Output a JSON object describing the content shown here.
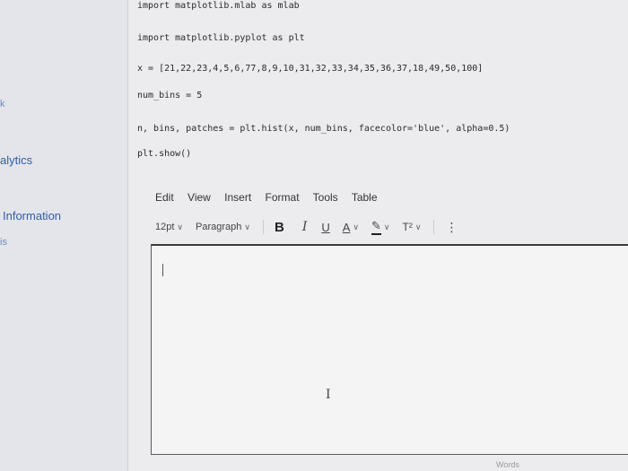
{
  "sidebar": {
    "items": [
      {
        "label": "k"
      },
      {
        "label": "alytics"
      },
      {
        "label": "Information"
      },
      {
        "label": "is"
      }
    ]
  },
  "code": {
    "lines": [
      "import matplotlib.mlab as mlab",
      "import matplotlib.pyplot as plt",
      "x = [21,22,23,4,5,6,77,8,9,10,31,32,33,34,35,36,37,18,49,50,100]",
      "num_bins = 5",
      "n, bins, patches = plt.hist(x, num_bins, facecolor='blue', alpha=0.5)",
      "plt.show()"
    ]
  },
  "editor": {
    "menu": [
      "Edit",
      "View",
      "Insert",
      "Format",
      "Tools",
      "Table"
    ],
    "toolbar": {
      "font_size": "12pt",
      "block_format": "Paragraph",
      "bold": "B",
      "italic": "I",
      "underline": "U",
      "text_color": "A",
      "highlight": "✎",
      "superscript": "T²",
      "more": "⋮",
      "chevron": "∨"
    },
    "ibeam": "I"
  },
  "footer": {
    "hint": "Words"
  }
}
